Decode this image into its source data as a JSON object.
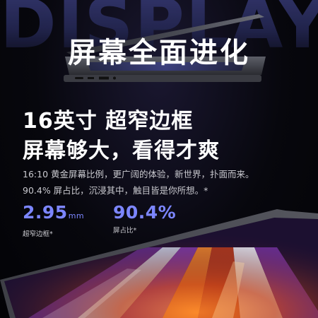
{
  "banner": {
    "background_word": "DISPLAY",
    "title": "屏幕全面进化"
  },
  "headline": {
    "line1": "16英寸 超窄边框",
    "line2": "屏幕够大，看得才爽"
  },
  "description": {
    "line1": "16:10 黄金屏幕比例，更广阔的体验，新世界，扑面而来。",
    "line2": "90.4% 屏占比，沉浸其中，触目皆是你所想。*"
  },
  "stats": [
    {
      "value": "2.95",
      "unit": "mm",
      "label": "超窄边框*"
    },
    {
      "value": "90.4%",
      "unit": "",
      "label": "屏占比*"
    }
  ],
  "colors": {
    "accent": "#7c86ff",
    "background": "#050509",
    "text": "#ffffff"
  }
}
